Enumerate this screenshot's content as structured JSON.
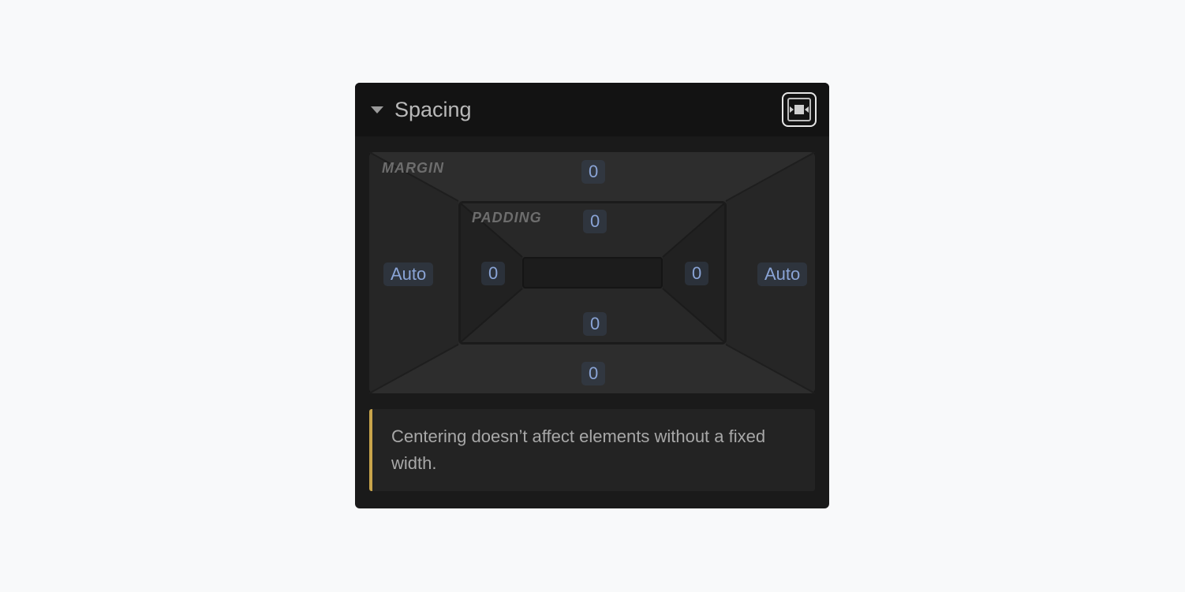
{
  "header": {
    "title": "Spacing"
  },
  "boxModel": {
    "marginLabel": "MARGIN",
    "paddingLabel": "PADDING",
    "margin": {
      "top": "0",
      "right": "Auto",
      "bottom": "0",
      "left": "Auto"
    },
    "padding": {
      "top": "0",
      "right": "0",
      "bottom": "0",
      "left": "0"
    }
  },
  "hint": {
    "text": "Centering doesn’t affect elements without a fixed width."
  }
}
